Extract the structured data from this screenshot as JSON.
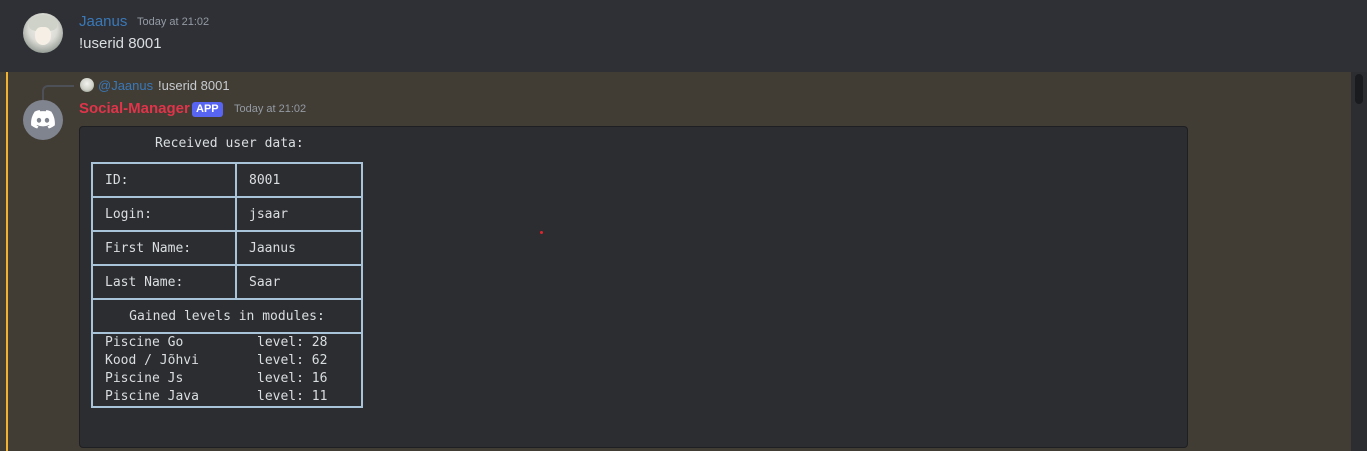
{
  "message1": {
    "username": "Jaanus",
    "timestamp": "Today at 21:02",
    "content": "!userid 8001"
  },
  "message2": {
    "reply": {
      "mention": "@Jaanus",
      "text": "!userid 8001"
    },
    "username": "Social-Manager",
    "badge": "APP",
    "timestamp": "Today at 21:02",
    "code_title": "Received user data:",
    "fields": [
      {
        "label": "ID:",
        "value": "8001"
      },
      {
        "label": "Login:",
        "value": "jsaar"
      },
      {
        "label": "First Name:",
        "value": "Jaanus"
      },
      {
        "label": "Last Name:",
        "value": "Saar"
      }
    ],
    "modules_header": "Gained levels in modules:",
    "modules": [
      {
        "name": "Piscine Go",
        "level": "level: 28"
      },
      {
        "name": "Kood / Jõhvi",
        "level": "level: 62"
      },
      {
        "name": "Piscine Js",
        "level": "level: 16"
      },
      {
        "name": "Piscine Java",
        "level": "level: 11"
      }
    ]
  },
  "colors": {
    "mention_highlight": "#413c34",
    "mention_bar": "#f0b232",
    "bot_name": "#e0344a",
    "user_name": "#3a78b8",
    "app_badge": "#5865f2"
  }
}
